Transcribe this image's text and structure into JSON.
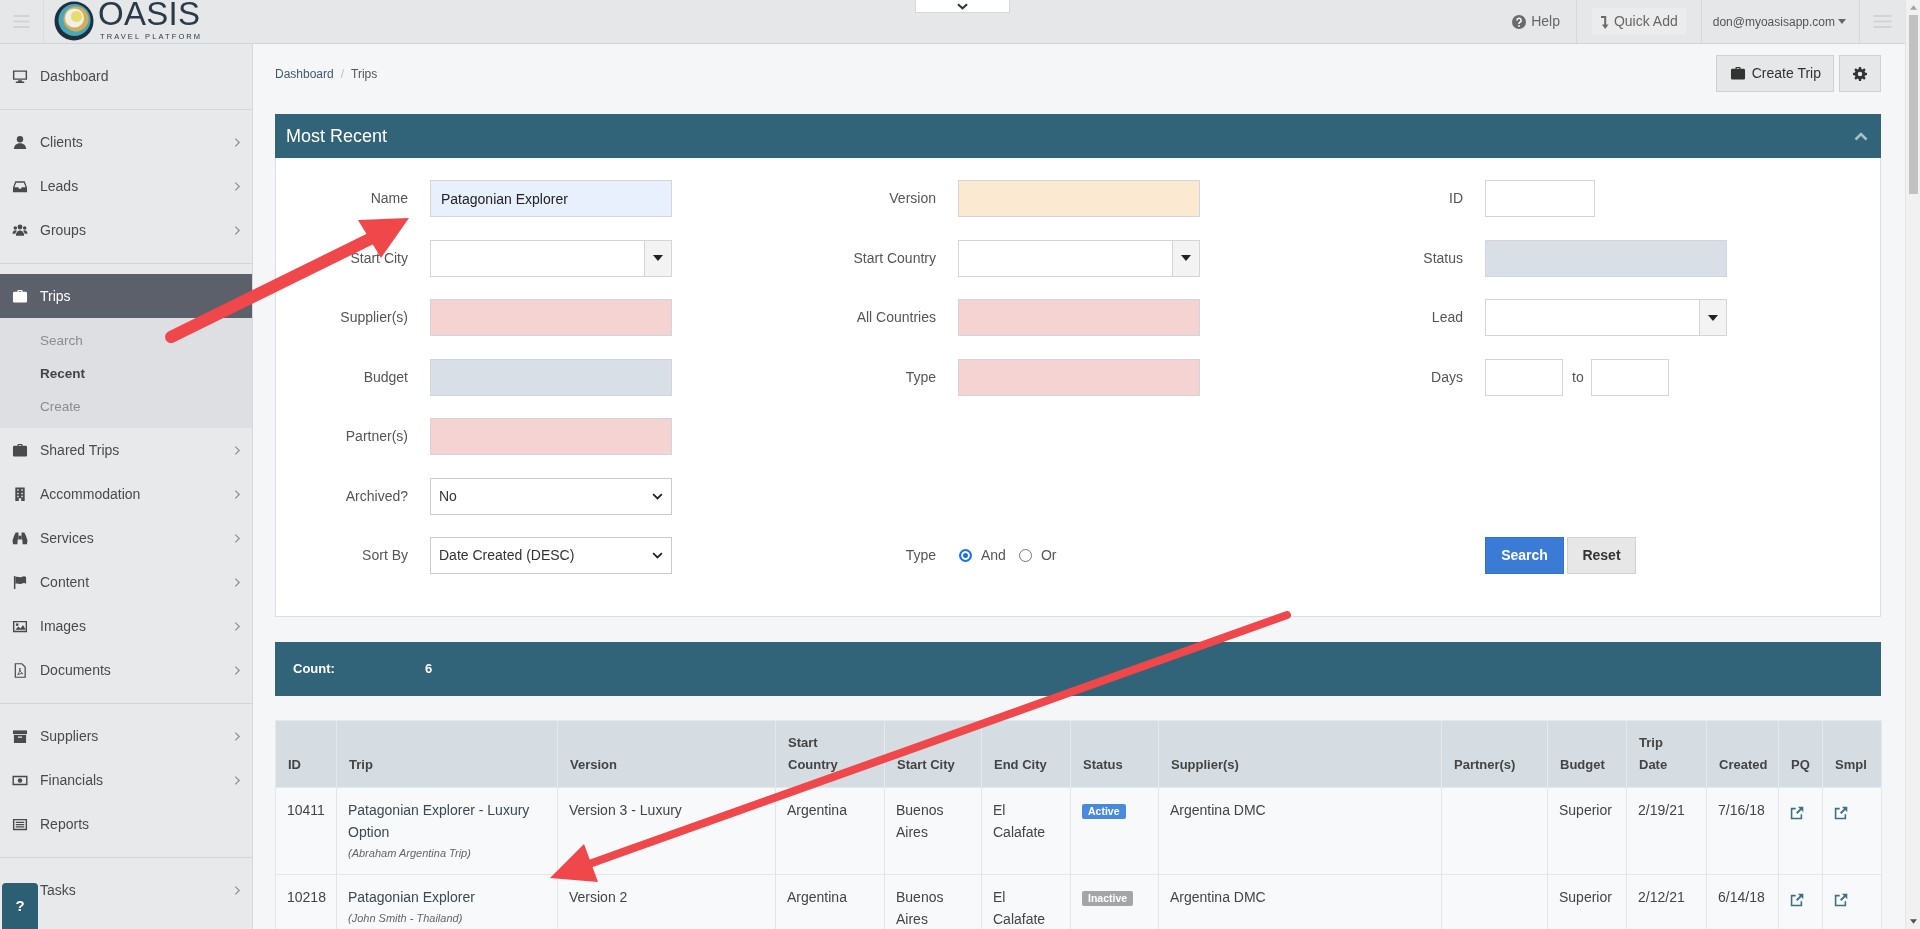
{
  "topbar": {
    "brand": "OASIS",
    "tagline": "TRAVEL PLATFORM",
    "links": [
      {
        "label": "Help"
      },
      {
        "label": "Quick Add"
      }
    ],
    "user": "don@myoasisapp.com"
  },
  "sidebar": {
    "sections": [
      {
        "items": [
          {
            "label": "Dashboard",
            "expandable": false,
            "selected": false
          }
        ]
      },
      {
        "items": [
          {
            "label": "Clients",
            "expandable": true,
            "selected": false
          },
          {
            "label": "Leads",
            "expandable": true,
            "selected": false
          },
          {
            "label": "Groups",
            "expandable": true,
            "selected": false
          }
        ]
      },
      {
        "items": [
          {
            "label": "Trips",
            "expandable": false,
            "selected": true,
            "expanded": true,
            "children": [
              {
                "label": "Search",
                "selected": false
              },
              {
                "label": "Recent",
                "selected": true
              },
              {
                "label": "Create",
                "selected": false
              }
            ]
          },
          {
            "label": "Shared Trips",
            "expandable": true,
            "selected": false
          },
          {
            "label": "Accommodation",
            "expandable": true,
            "selected": false
          },
          {
            "label": "Services",
            "expandable": true,
            "selected": false
          },
          {
            "label": "Content",
            "expandable": true,
            "selected": false
          },
          {
            "label": "Images",
            "expandable": true,
            "selected": false
          },
          {
            "label": "Documents",
            "expandable": true,
            "selected": false
          }
        ]
      },
      {
        "items": [
          {
            "label": "Suppliers",
            "expandable": true,
            "selected": false
          },
          {
            "label": "Financials",
            "expandable": true,
            "selected": false
          },
          {
            "label": "Reports",
            "expandable": false,
            "selected": false
          }
        ]
      },
      {
        "items": [
          {
            "label": "Tasks",
            "expandable": true,
            "selected": false
          }
        ]
      }
    ]
  },
  "help_button": "?",
  "breadcrumb": {
    "items": [
      "Dashboard",
      "Trips"
    ],
    "separator": "/"
  },
  "toolbar": {
    "create_button": "Create Trip"
  },
  "panel": {
    "title": "Most Recent",
    "expanded": true,
    "rows": [
      [
        {
          "label": "Name",
          "kind": "text",
          "value": "Patagonian Explorer",
          "color": "#e8f0fe"
        },
        {
          "label": "Version",
          "kind": "text",
          "color": "#fce9d2"
        },
        {
          "label": "ID",
          "kind": "short"
        }
      ],
      [
        {
          "label": "Start City",
          "kind": "combo"
        },
        {
          "label": "Start Country",
          "kind": "combo"
        },
        {
          "label": "Status",
          "kind": "text",
          "color": "#d9dfe7"
        }
      ],
      [
        {
          "label": "Supplier(s)",
          "kind": "text",
          "color": "#f6d3d3"
        },
        {
          "label": "All Countries",
          "kind": "text",
          "color": "#f6d3d3"
        },
        {
          "label": "Lead",
          "kind": "combo"
        }
      ],
      [
        {
          "label": "Budget",
          "kind": "text",
          "color": "#d9dfe7"
        },
        {
          "label": "Type",
          "kind": "text",
          "color": "#f6d3d3"
        },
        {
          "label": "Days",
          "kind": "range",
          "joiner": "to"
        }
      ],
      [
        {
          "label": "Partner(s)",
          "kind": "text",
          "color": "#f6d3d3"
        }
      ],
      [
        {
          "label": "Archived?",
          "kind": "select",
          "value": "No"
        }
      ],
      [
        {
          "label": "Sort By",
          "kind": "select",
          "value": "Date Created (DESC)"
        },
        {
          "label": "Type",
          "kind": "radio",
          "options": [
            {
              "label": "And",
              "selected": true
            },
            {
              "label": "Or",
              "selected": false
            }
          ]
        },
        {
          "kind": "buttons",
          "buttons": [
            {
              "label": "Search",
              "kind": "primary"
            },
            {
              "label": "Reset",
              "kind": "secondary"
            }
          ]
        }
      ]
    ]
  },
  "count_bar": {
    "label": "Count:",
    "value": "6"
  },
  "table": {
    "columns": [
      "ID",
      "Trip",
      "Version",
      "Start Country",
      "Start City",
      "End City",
      "Status",
      "Supplier(s)",
      "Partner(s)",
      "Budget",
      "Trip Date",
      "Created",
      "PQ",
      "Smpl"
    ],
    "rows": [
      {
        "id": "10411",
        "trip": "Patagonian Explorer - Luxury Option",
        "trip_note": "(Abraham Argentina Trip)",
        "version": "Version 3 - Luxury",
        "start_country": "Argentina",
        "start_city": "Buenos Aires",
        "end_city": "El Calafate",
        "status": {
          "label": "Active",
          "color": "#4a89dc"
        },
        "suppliers": "Argentina DMC",
        "budget": "Superior",
        "trip_date": "2/19/21",
        "created": "7/16/18"
      },
      {
        "id": "10218",
        "trip": "Patagonian Explorer",
        "trip_note": "(John Smith - Thailand)",
        "version": "Version 2",
        "start_country": "Argentina",
        "start_city": "Buenos Aires",
        "end_city": "El Calafate",
        "status": {
          "label": "Inactive",
          "color": "#a5a5a5"
        },
        "suppliers": "Argentina DMC",
        "budget": "Superior",
        "trip_date": "2/12/21",
        "created": "6/14/18"
      }
    ]
  }
}
